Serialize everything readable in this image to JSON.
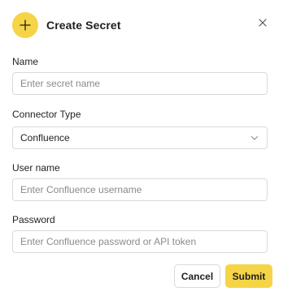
{
  "dialog": {
    "title": "Create Secret",
    "close_icon": "close-icon",
    "add_icon": "plus-icon",
    "accent_color": "#f5d547"
  },
  "fields": {
    "name": {
      "label": "Name",
      "placeholder": "Enter secret name",
      "value": ""
    },
    "connector_type": {
      "label": "Connector Type",
      "value": "Confluence",
      "icon": "chevron-down-icon"
    },
    "username": {
      "label": "User name",
      "placeholder": "Enter Confluence username",
      "value": ""
    },
    "password": {
      "label": "Password",
      "placeholder": "Enter Confluence password or API token",
      "value": ""
    }
  },
  "actions": {
    "cancel_label": "Cancel",
    "submit_label": "Submit"
  }
}
